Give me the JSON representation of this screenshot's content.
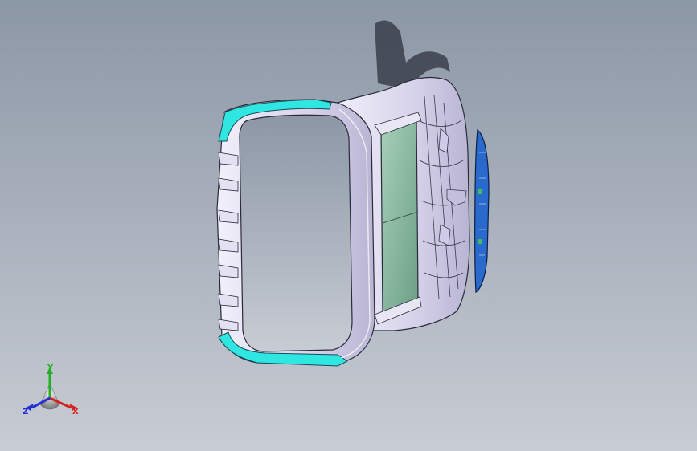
{
  "viewport": {
    "background_top": "#8c97a6",
    "background_bottom": "#c8ccd4"
  },
  "model": {
    "body_color": "#dcd9ee",
    "edge_color": "#2a2a3a",
    "trim_color": "#30e6e0",
    "glass_color": "#7fb89a",
    "cover_color": "#2a6acc"
  },
  "triad": {
    "x_label": "X",
    "y_label": "Y",
    "z_label": "Z",
    "x_color": "#d82020",
    "y_color": "#20b020",
    "z_color": "#2030d8"
  }
}
